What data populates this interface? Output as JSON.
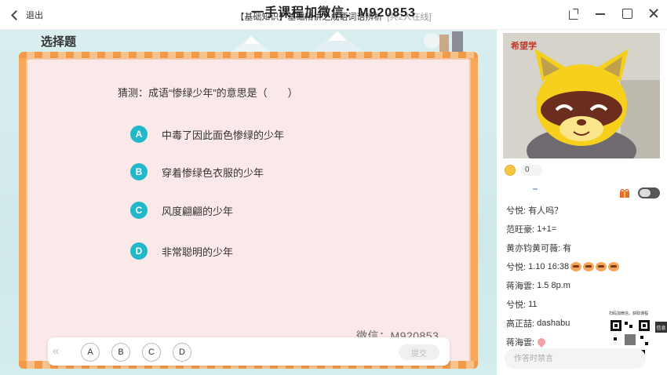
{
  "titlebar": {
    "back_label": "退出",
    "title": "【基础知识】基础精讲之成语词语辨析",
    "online": "[共2人在线]",
    "watermark": "一手课程加微信：M920853"
  },
  "slide": {
    "header": "选择题",
    "question": "猜测：成语“惨绿少年”的意思是（　　）",
    "options": [
      {
        "letter": "A",
        "text": "中毒了因此面色惨绿的少年"
      },
      {
        "letter": "B",
        "text": "穿着惨绿色衣服的少年"
      },
      {
        "letter": "C",
        "text": "风度翩翩的少年"
      },
      {
        "letter": "D",
        "text": "非常聪明的少年"
      }
    ],
    "watermark": "微信：M920853"
  },
  "answerbar": {
    "collapse_icon": "double-chevron-left-icon",
    "choices": [
      "A",
      "B",
      "C",
      "D"
    ],
    "submit_label": "提交"
  },
  "panel": {
    "video_label": "希望学",
    "coin_count": "0",
    "messages": [
      {
        "name": "兮悦:",
        "text": "有人吗？"
      },
      {
        "name": "范旺豪:",
        "text": "1+1="
      },
      {
        "name": "黄亦钧黄可薇:",
        "text": "有"
      },
      {
        "name": "兮悦:",
        "text": "1.10 16:38",
        "emojis": 4
      },
      {
        "name": "蒋海雲:",
        "text": "1.5 8p.m"
      },
      {
        "name": "兮悦:",
        "text": "11"
      },
      {
        "name": "高正喆:",
        "text": "dashabu"
      },
      {
        "name": "蒋海雲:",
        "text": "",
        "heart": true
      }
    ],
    "qr_caption": "扫码加微信，获取课程",
    "side_tag": "信息",
    "input_placeholder": "作答时禁言"
  },
  "colors": {
    "accent": "#22b8c9",
    "frame": "#f6a85c",
    "card": "#fbe8e9"
  }
}
